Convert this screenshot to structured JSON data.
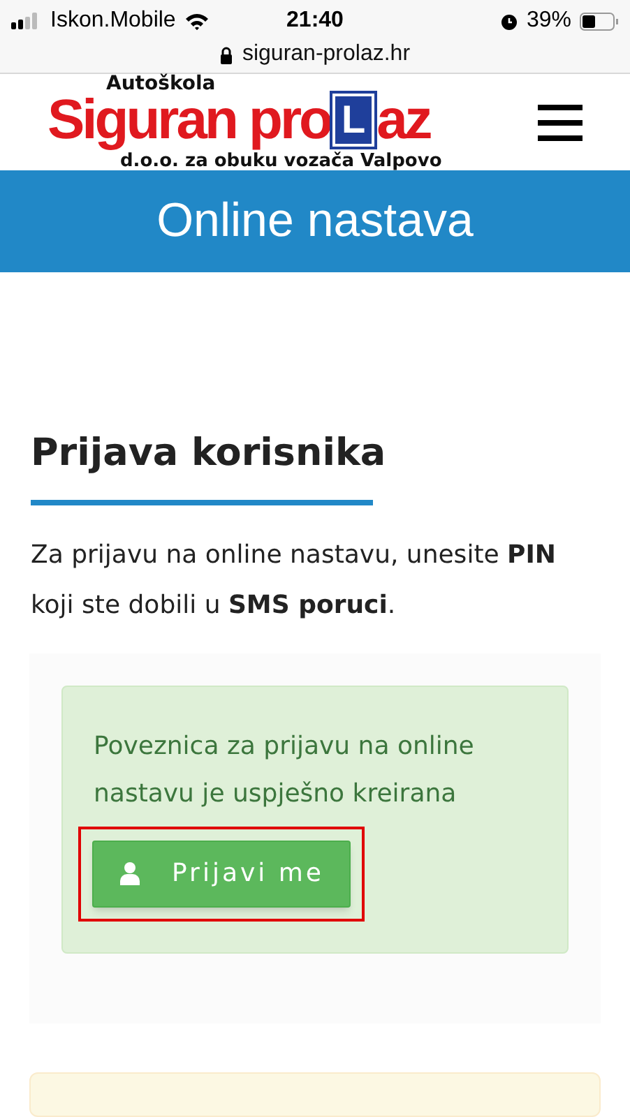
{
  "status_bar": {
    "carrier": "Iskon.Mobile",
    "time": "21:40",
    "battery": "39%"
  },
  "url_bar": {
    "url": "siguran-prolaz.hr"
  },
  "logo": {
    "top": "Autoškola",
    "main": "Siguran pro",
    "letter": "L",
    "end": "az",
    "sub": "d.o.o. za obuku vozača Valpovo"
  },
  "banner": {
    "title": "Online nastava"
  },
  "heading": "Prijava korisnika",
  "intro": "Za prijavu na online nastavu, unesite **PIN** koji ste dobili u **SMS poruci**.",
  "alert": {
    "message": "Poveznica za prijavu na online nastavu je uspješno kreirana",
    "button": {
      "label": "Prijavi me",
      "highlighted": true
    }
  }
}
